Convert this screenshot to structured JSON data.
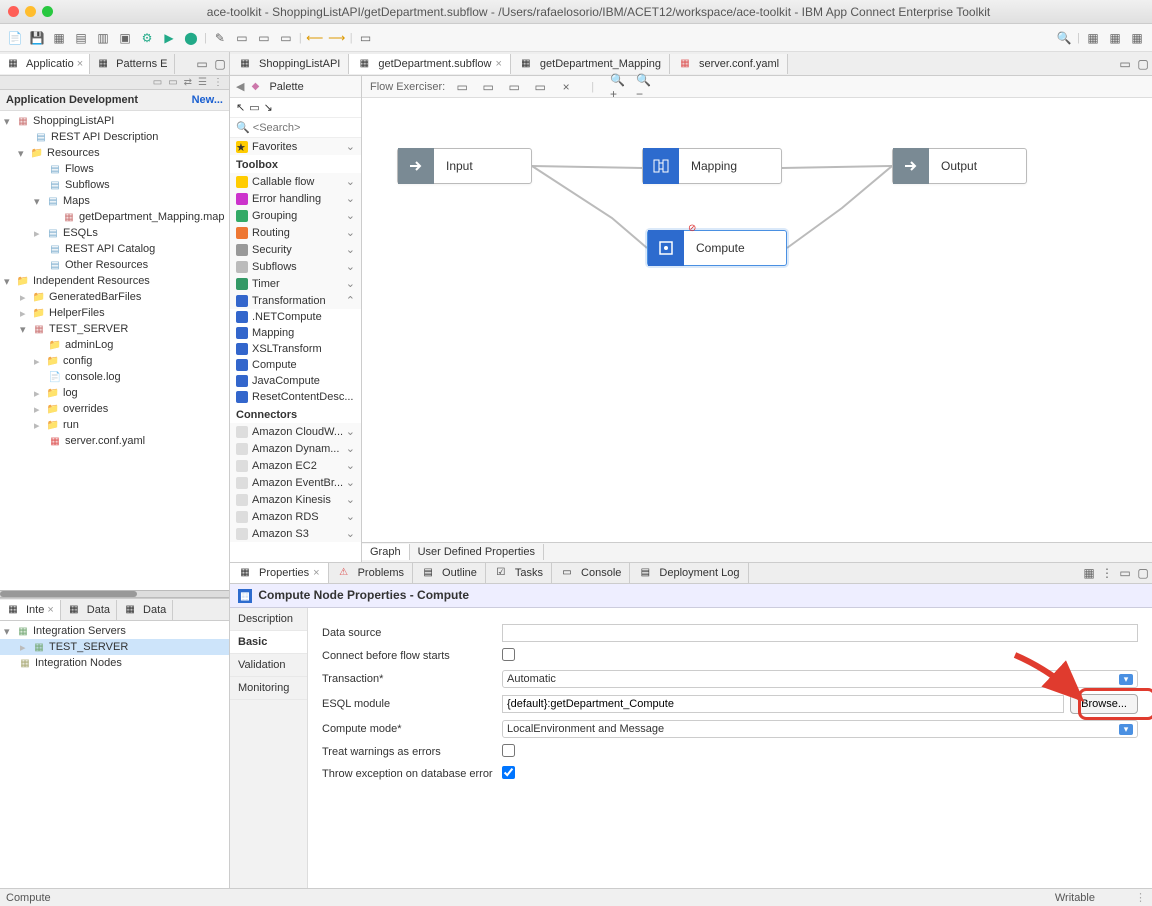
{
  "window": {
    "title": "ace-toolkit - ShoppingListAPI/getDepartment.subflow - /Users/rafaelosorio/IBM/ACET12/workspace/ace-toolkit - IBM App Connect Enterprise Toolkit"
  },
  "leftViews": {
    "tab1": "Applicatio",
    "tab2": "Patterns E"
  },
  "appDev": {
    "title": "Application Development",
    "newLink": "New..."
  },
  "tree": {
    "n0": "ShoppingListAPI",
    "n1": "REST API Description",
    "n2": "Resources",
    "n3": "Flows",
    "n4": "Subflows",
    "n5": "Maps",
    "n6": "getDepartment_Mapping.map",
    "n7": "ESQLs",
    "n8": "REST API Catalog",
    "n9": "Other Resources",
    "n10": "Independent Resources",
    "n11": "GeneratedBarFiles",
    "n12": "HelperFiles",
    "n13": "TEST_SERVER",
    "n14": "adminLog",
    "n15": "config",
    "n16": "console.log",
    "n17": "log",
    "n18": "overrides",
    "n19": "run",
    "n20": "server.conf.yaml"
  },
  "editorTabs": {
    "t0": "ShoppingListAPI",
    "t1": "getDepartment.subflow",
    "t2": "getDepartment_Mapping",
    "t3": "server.conf.yaml"
  },
  "palette": {
    "title": "Palette",
    "searchPlaceholder": "<Search>",
    "favorites": "Favorites",
    "toolbox": "Toolbox",
    "i0": "Callable flow",
    "i1": "Error handling",
    "i2": "Grouping",
    "i3": "Routing",
    "i4": "Security",
    "i5": "Subflows",
    "i6": "Timer",
    "i7": "Transformation",
    "i8": ".NETCompute",
    "i9": "Mapping",
    "i10": "XSLTransform",
    "i11": "Compute",
    "i12": "JavaCompute",
    "i13": "ResetContentDesc...",
    "connectors": "Connectors",
    "c0": "Amazon CloudW...",
    "c1": "Amazon Dynam...",
    "c2": "Amazon EC2",
    "c3": "Amazon EventBr...",
    "c4": "Amazon Kinesis",
    "c5": "Amazon RDS",
    "c6": "Amazon S3"
  },
  "flowExerciser": "Flow Exerciser:",
  "nodes": {
    "input": "Input",
    "mapping": "Mapping",
    "compute": "Compute",
    "output": "Output"
  },
  "bottomTabs": {
    "graph": "Graph",
    "udp": "User Defined Properties"
  },
  "propsTabs": {
    "properties": "Properties",
    "problems": "Problems",
    "outline": "Outline",
    "tasks": "Tasks",
    "console": "Console",
    "deployLog": "Deployment Log"
  },
  "propsTitle": "Compute Node Properties - Compute",
  "propsSide": {
    "desc": "Description",
    "basic": "Basic",
    "validation": "Validation",
    "monitoring": "Monitoring"
  },
  "form": {
    "dataSourceLabel": "Data source",
    "dataSourceValue": "",
    "connectLabel": "Connect before flow starts",
    "transactionLabel": "Transaction*",
    "transactionValue": "Automatic",
    "esqlLabel": "ESQL module",
    "esqlValue": "{default}:getDepartment_Compute",
    "browse": "Browse...",
    "computeModeLabel": "Compute mode*",
    "computeModeValue": "LocalEnvironment and Message",
    "warningsLabel": "Treat warnings as errors",
    "throwLabel": "Throw exception on database error"
  },
  "intPanel": {
    "tab1": "Inte",
    "tab2": "Data",
    "tab3": "Data",
    "servers": "Integration Servers",
    "testServer": "TEST_SERVER",
    "intNodes": "Integration Nodes"
  },
  "status": {
    "left": "Compute",
    "right": "Writable"
  }
}
